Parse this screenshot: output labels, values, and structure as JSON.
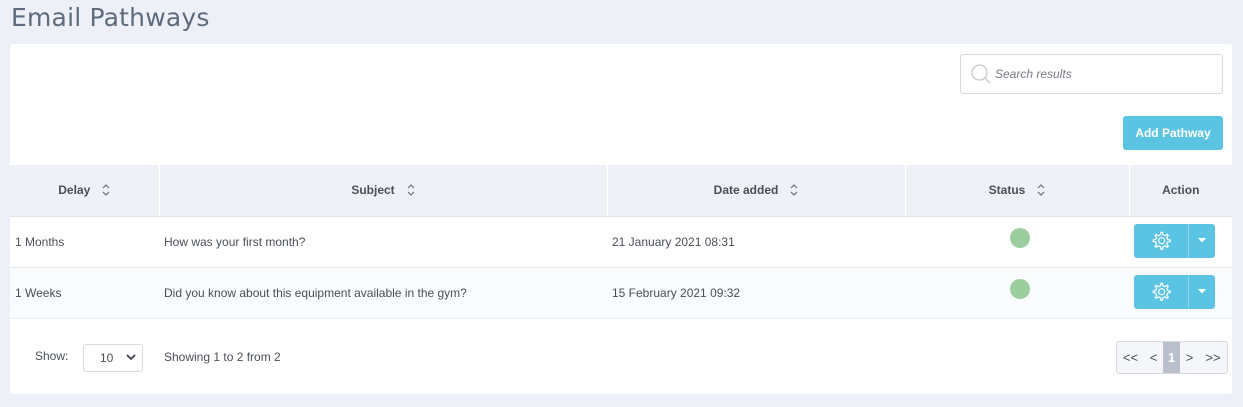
{
  "page": {
    "title": "Email Pathways"
  },
  "search": {
    "placeholder": "Search results"
  },
  "toolbar": {
    "add_label": "Add Pathway"
  },
  "table": {
    "columns": [
      "Delay",
      "Subject",
      "Date added",
      "Status",
      "Action"
    ],
    "rows": [
      {
        "delay": "1 Months",
        "subject": "How was your first month?",
        "date_added": "21 January 2021 08:31",
        "status": "active"
      },
      {
        "delay": "1 Weeks",
        "subject": "Did you know about this equipment available in the gym?",
        "date_added": "15 February 2021 09:32",
        "status": "active"
      }
    ]
  },
  "footer": {
    "show_label": "Show:",
    "page_size": "10",
    "showing_text": "Showing 1 to 2 from 2",
    "pager": {
      "first": "<<",
      "prev": "<",
      "current": "1",
      "next": ">",
      "last": ">>"
    }
  },
  "colors": {
    "accent": "#5bc4e2",
    "status_active": "#9ccd9e",
    "background": "#edf1f7"
  },
  "icons": {
    "search": "search-icon",
    "sort": "sort-icon",
    "settings": "gear-icon",
    "dropdown": "caret-down-icon"
  }
}
